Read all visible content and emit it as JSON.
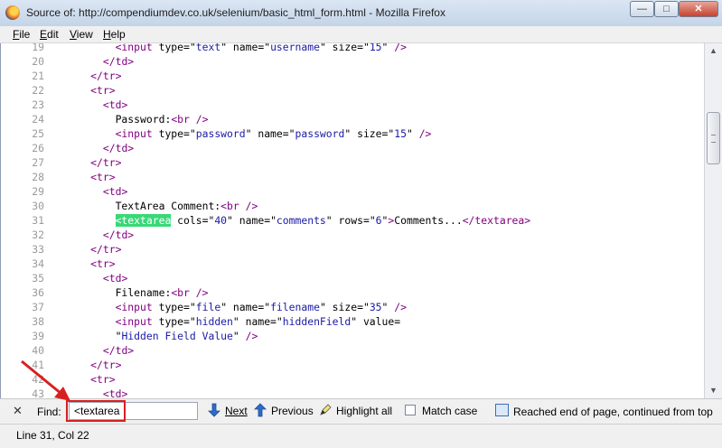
{
  "window": {
    "title": "Source of: http://compendiumdev.co.uk/selenium/basic_html_form.html - Mozilla Firefox"
  },
  "menu": [
    {
      "label": "File",
      "accel": "F",
      "rest": "ile"
    },
    {
      "label": "Edit",
      "accel": "E",
      "rest": "dit"
    },
    {
      "label": "View",
      "accel": "V",
      "rest": "iew"
    },
    {
      "label": "Help",
      "accel": "H",
      "rest": "elp"
    }
  ],
  "source": {
    "lines": [
      {
        "n": "19",
        "html": "          <span class=\"tag\">&lt;input</span> <span class=\"attr\">type=</span>\"<span class=\"val\">text</span>\" <span class=\"attr\">name=</span>\"<span class=\"val\">username</span>\" <span class=\"attr\">size=</span>\"<span class=\"val\">15</span>\" <span class=\"tag\">/&gt;</span>"
      },
      {
        "n": "20",
        "html": "        <span class=\"tag\">&lt;/td&gt;</span>"
      },
      {
        "n": "21",
        "html": "      <span class=\"tag\">&lt;/tr&gt;</span>"
      },
      {
        "n": "22",
        "html": "      <span class=\"tag\">&lt;tr&gt;</span>"
      },
      {
        "n": "23",
        "html": "        <span class=\"tag\">&lt;td&gt;</span>"
      },
      {
        "n": "24",
        "html": "          Password:<span class=\"tag\">&lt;br /&gt;</span>"
      },
      {
        "n": "25",
        "html": "          <span class=\"tag\">&lt;input</span> <span class=\"attr\">type=</span>\"<span class=\"val\">password</span>\" <span class=\"attr\">name=</span>\"<span class=\"val\">password</span>\" <span class=\"attr\">size=</span>\"<span class=\"val\">15</span>\" <span class=\"tag\">/&gt;</span>"
      },
      {
        "n": "26",
        "html": "        <span class=\"tag\">&lt;/td&gt;</span>"
      },
      {
        "n": "27",
        "html": "      <span class=\"tag\">&lt;/tr&gt;</span>"
      },
      {
        "n": "28",
        "html": "      <span class=\"tag\">&lt;tr&gt;</span>"
      },
      {
        "n": "29",
        "html": "        <span class=\"tag\">&lt;td&gt;</span>"
      },
      {
        "n": "30",
        "html": "          TextArea Comment:<span class=\"tag\">&lt;br /&gt;</span>"
      },
      {
        "n": "31",
        "html": "          <span class=\"hl\">&lt;textarea</span> <span class=\"attr\">cols=</span>\"<span class=\"val\">40</span>\" <span class=\"attr\">name=</span>\"<span class=\"val\">comments</span>\" <span class=\"attr\">rows=</span>\"<span class=\"val\">6</span>\"<span class=\"tag\">&gt;</span>Comments...<span class=\"tag\">&lt;/textarea&gt;</span>"
      },
      {
        "n": "32",
        "html": "        <span class=\"tag\">&lt;/td&gt;</span>"
      },
      {
        "n": "33",
        "html": "      <span class=\"tag\">&lt;/tr&gt;</span>"
      },
      {
        "n": "34",
        "html": "      <span class=\"tag\">&lt;tr&gt;</span>"
      },
      {
        "n": "35",
        "html": "        <span class=\"tag\">&lt;td&gt;</span>"
      },
      {
        "n": "36",
        "html": "          Filename:<span class=\"tag\">&lt;br /&gt;</span>"
      },
      {
        "n": "37",
        "html": "          <span class=\"tag\">&lt;input</span> <span class=\"attr\">type=</span>\"<span class=\"val\">file</span>\" <span class=\"attr\">name=</span>\"<span class=\"val\">filename</span>\" <span class=\"attr\">size=</span>\"<span class=\"val\">35</span>\" <span class=\"tag\">/&gt;</span>"
      },
      {
        "n": "38",
        "html": "          <span class=\"tag\">&lt;input</span> <span class=\"attr\">type=</span>\"<span class=\"val\">hidden</span>\" <span class=\"attr\">name=</span>\"<span class=\"val\">hiddenField</span>\" <span class=\"attr\">value=</span>"
      },
      {
        "n": "39",
        "html": "          \"<span class=\"val\">Hidden Field Value</span>\" <span class=\"tag\">/&gt;</span>"
      },
      {
        "n": "40",
        "html": "        <span class=\"tag\">&lt;/td&gt;</span>"
      },
      {
        "n": "41",
        "html": "      <span class=\"tag\">&lt;/tr&gt;</span>"
      },
      {
        "n": "42",
        "html": "      <span class=\"tag\">&lt;tr&gt;</span>"
      },
      {
        "n": "43",
        "html": "        <span class=\"tag\">&lt;td&gt;</span>"
      }
    ]
  },
  "findbar": {
    "label": "Find:",
    "value": "<textarea",
    "next_label": "Next",
    "previous_label": "Previous",
    "highlight_label": "Highlight all",
    "match_case_label": "Match case",
    "status_message": "Reached end of page, continued from top"
  },
  "statusbar": {
    "text": "Line 31, Col 22"
  },
  "colors": {
    "highlight": "#38d878",
    "tag": "#800080",
    "value": "#1a1aa6",
    "annotation": "#d82020"
  }
}
